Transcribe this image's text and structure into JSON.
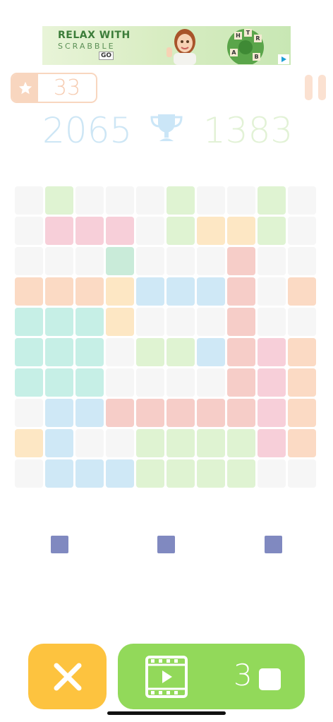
{
  "ad": {
    "line1": "RELAX WITH",
    "line2": "SCRABBLE",
    "badge": "GO",
    "wheel_letters": [
      "H",
      "T",
      "R",
      "A",
      "B"
    ]
  },
  "level": {
    "value": "33",
    "icon": "star-icon"
  },
  "score": {
    "current": "2065",
    "best": "1383",
    "icon": "trophy-icon"
  },
  "colors": {
    "empty": "#f6f6f6",
    "green": "#dff3d2",
    "pink": "#f7cfd9",
    "yellow": "#fde7c4",
    "mint": "#c9ebd9",
    "salmon": "#f6cdc8",
    "peach": "#fbdac4",
    "blue": "#cfe8f6",
    "teal": "#c6efe6",
    "piece": "#8089c0",
    "button_x": "#fdc33f",
    "button_video": "#92d95a"
  },
  "grid": [
    [
      "empty",
      "green",
      "empty",
      "empty",
      "empty",
      "green",
      "empty",
      "empty",
      "green",
      "empty"
    ],
    [
      "empty",
      "pink",
      "pink",
      "pink",
      "empty",
      "green",
      "yellow",
      "yellow",
      "green",
      "empty"
    ],
    [
      "empty",
      "empty",
      "empty",
      "mint",
      "empty",
      "empty",
      "empty",
      "salmon",
      "empty",
      "empty"
    ],
    [
      "peach",
      "peach",
      "peach",
      "yellow",
      "blue",
      "blue",
      "blue",
      "salmon",
      "empty",
      "peach"
    ],
    [
      "teal",
      "teal",
      "teal",
      "yellow",
      "empty",
      "empty",
      "empty",
      "salmon",
      "empty",
      "empty"
    ],
    [
      "teal",
      "teal",
      "teal",
      "empty",
      "green",
      "green",
      "blue",
      "salmon",
      "pink",
      "peach"
    ],
    [
      "teal",
      "teal",
      "teal",
      "empty",
      "empty",
      "empty",
      "empty",
      "salmon",
      "pink",
      "peach"
    ],
    [
      "empty",
      "blue",
      "blue",
      "salmon",
      "salmon",
      "salmon",
      "salmon",
      "salmon",
      "pink",
      "peach"
    ],
    [
      "yellow",
      "blue",
      "empty",
      "empty",
      "green",
      "green",
      "green",
      "green",
      "pink",
      "peach"
    ],
    [
      "empty",
      "blue",
      "blue",
      "blue",
      "green",
      "green",
      "green",
      "green",
      "empty",
      "empty"
    ]
  ],
  "pieces": [
    "small-square",
    "small-square",
    "small-square"
  ],
  "buttons": {
    "close_icon": "close-icon",
    "video_icon": "video-icon",
    "video_count": "3"
  }
}
